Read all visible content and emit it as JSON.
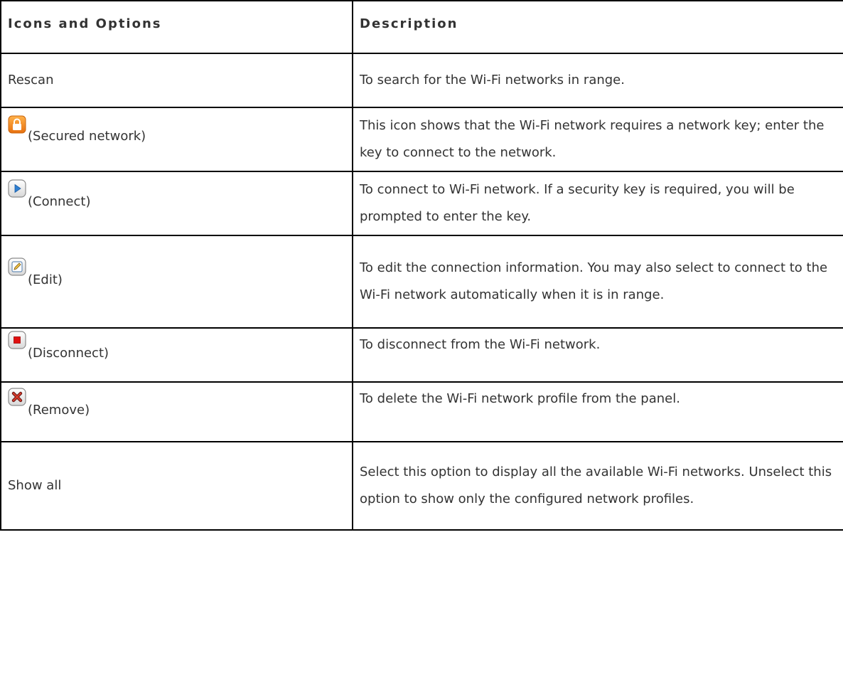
{
  "table": {
    "headers": {
      "options": "Icons and Options",
      "description": "Description"
    },
    "rows": [
      {
        "option": "Rescan",
        "icon": null,
        "description": "To search for the Wi-Fi networks in range."
      },
      {
        "option": "(Secured network)",
        "icon": "lock-icon",
        "description": "This icon shows that the Wi-Fi network requires a network key; enter the key to connect to the network."
      },
      {
        "option": "(Connect)",
        "icon": "play-icon",
        "description": "To connect to Wi-Fi network. If a security key is required, you will be prompted to enter the key."
      },
      {
        "option": "(Edit)",
        "icon": "edit-icon",
        "description": "To edit the connection information. You may also select to connect to the Wi-Fi network automatically when it is in range."
      },
      {
        "option": "(Disconnect)",
        "icon": "stop-icon",
        "description": "To disconnect from the Wi-Fi network."
      },
      {
        "option": "(Remove)",
        "icon": "remove-icon",
        "description": "To delete the Wi-Fi network profile from the panel."
      },
      {
        "option": "Show all",
        "icon": null,
        "description": "Select this option to display all the available Wi-Fi networks. Unselect this option to show only the configured network profiles."
      }
    ]
  },
  "colors": {
    "text": "#333333",
    "border": "#000000",
    "lock_orange": "#f08a1c",
    "play_blue": "#2f7fd0",
    "stop_red": "#e01010",
    "remove_red": "#c62828"
  }
}
